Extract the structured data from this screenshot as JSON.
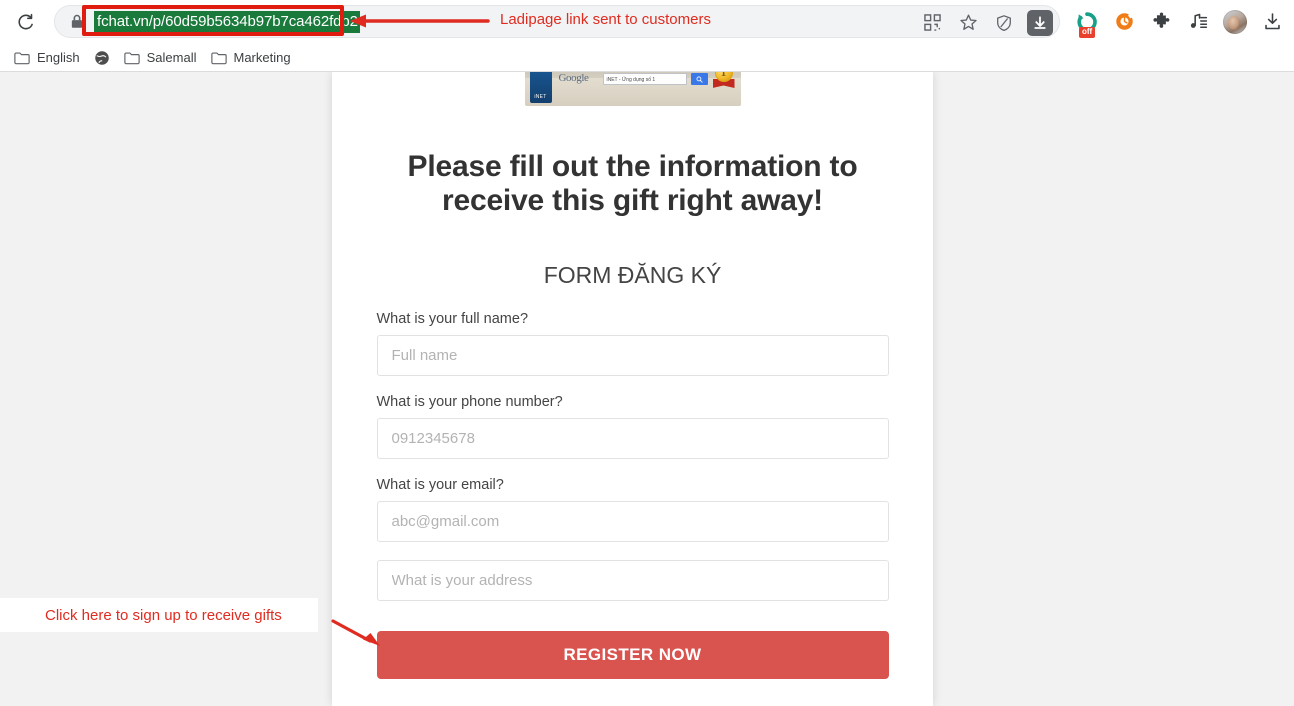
{
  "browser": {
    "reload_icon": "reload-icon",
    "lock_icon": "lock-icon",
    "url": "fchat.vn/p/60d59b5634b97b7ca462fdb2",
    "omnibox_icons": [
      {
        "name": "qr-code-icon",
        "label": "QR code"
      },
      {
        "name": "bookmark-star-icon",
        "label": "Bookmark"
      },
      {
        "name": "shield-icon",
        "label": "Tracking protection"
      },
      {
        "name": "download-icon",
        "label": "Downloads",
        "active": true
      }
    ],
    "extensions": [
      {
        "name": "adblock-off-icon",
        "badge": "off"
      },
      {
        "name": "orange-circle-extension-icon",
        "badge": ""
      },
      {
        "name": "puzzle-piece-icon",
        "badge": ""
      },
      {
        "name": "music-playlist-icon",
        "badge": ""
      },
      {
        "name": "avatar",
        "badge": ""
      },
      {
        "name": "download-tray-icon",
        "badge": ""
      }
    ],
    "bookmarks": [
      {
        "icon": "folder-icon",
        "label": "English"
      },
      {
        "icon": "globe-icon",
        "label": ""
      },
      {
        "icon": "folder-icon",
        "label": "Salemall"
      },
      {
        "icon": "folder-icon",
        "label": "Marketing"
      }
    ]
  },
  "annotations": {
    "url_note": "Ladipage link sent to customers",
    "button_note": "Click here to sign up to receive gifts",
    "color": "#e02b20"
  },
  "page": {
    "banner": {
      "side_label": "iNET",
      "logo_text": "Google",
      "search_text": "iNET - Ứng dụng số 1",
      "medal_number": "1"
    },
    "heading": "Please fill out the information to receive this gift right away!",
    "form_title": "FORM ĐĂNG KÝ",
    "fields": [
      {
        "label": "What is your full name?",
        "placeholder": "Full name",
        "value": ""
      },
      {
        "label": "What is your phone number?",
        "placeholder": "0912345678",
        "value": ""
      },
      {
        "label": "What is your email?",
        "placeholder": "abc@gmail.com",
        "value": ""
      }
    ],
    "address_field": {
      "label": "",
      "placeholder": "What is your address",
      "value": ""
    },
    "submit_label": "REGISTER NOW",
    "submit_color": "#d9534f"
  }
}
